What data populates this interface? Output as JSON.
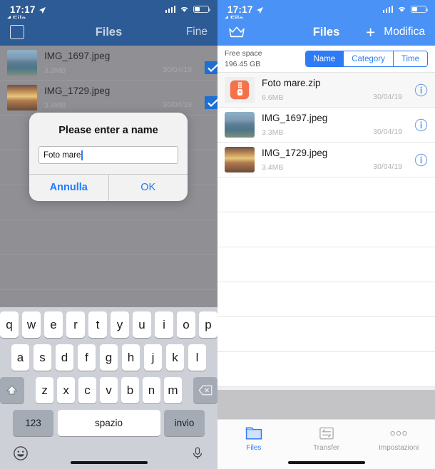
{
  "left": {
    "status": {
      "time": "17:17",
      "location_icon": "location-arrow-icon",
      "signal_icon": "cellular-bars-icon",
      "wifi_icon": "wifi-icon",
      "battery_icon": "battery-icon"
    },
    "back_label": "File",
    "nav": {
      "select_all_icon": "select-square-icon",
      "title": "Files",
      "done_label": "Fine"
    },
    "files": [
      {
        "name": "IMG_1697.jpeg",
        "size": "3.3MB",
        "date": "30/04/19",
        "thumb": "beach-thumbnail",
        "selected": true
      },
      {
        "name": "IMG_1729.jpeg",
        "size": "3.4MB",
        "date": "30/04/19",
        "thumb": "sunset-thumbnail",
        "selected": true
      }
    ],
    "dialog": {
      "title": "Please enter a name",
      "input_value": "Foto mare",
      "cancel_label": "Annulla",
      "ok_label": "OK"
    },
    "keyboard": {
      "row1": [
        "q",
        "w",
        "e",
        "r",
        "t",
        "y",
        "u",
        "i",
        "o",
        "p"
      ],
      "row2": [
        "a",
        "s",
        "d",
        "f",
        "g",
        "h",
        "j",
        "k",
        "l"
      ],
      "row3": [
        "z",
        "x",
        "c",
        "v",
        "b",
        "n",
        "m"
      ],
      "shift_icon": "shift-icon",
      "backspace_icon": "backspace-icon",
      "numbers_label": "123",
      "space_label": "spazio",
      "return_label": "invio",
      "emoji_icon": "emoji-icon",
      "dictation_icon": "microphone-icon"
    }
  },
  "right": {
    "status": {
      "time": "17:17",
      "location_icon": "location-arrow-icon",
      "signal_icon": "cellular-bars-icon",
      "wifi_icon": "wifi-icon",
      "battery_icon": "battery-icon"
    },
    "back_label": "File",
    "nav": {
      "premium_icon": "crown-icon",
      "title": "Files",
      "add_icon": "plus-icon",
      "edit_label": "Modifica"
    },
    "subbar": {
      "free_space_label": "Free space",
      "free_space_value": "196.45 GB",
      "segments": [
        {
          "label": "Name",
          "active": true
        },
        {
          "label": "Category",
          "active": false
        },
        {
          "label": "Time",
          "active": false
        }
      ]
    },
    "files": [
      {
        "name": "Foto mare.zip",
        "size": "6.6MB",
        "date": "30/04/19",
        "thumb": "zip-archive-icon",
        "info_icon": "info-icon"
      },
      {
        "name": "IMG_1697.jpeg",
        "size": "3.3MB",
        "date": "30/04/19",
        "thumb": "beach-thumbnail",
        "info_icon": "info-icon"
      },
      {
        "name": "IMG_1729.jpeg",
        "size": "3.4MB",
        "date": "30/04/19",
        "thumb": "sunset-thumbnail",
        "info_icon": "info-icon"
      }
    ],
    "tabs": [
      {
        "label": "Files",
        "icon": "folder-icon",
        "active": true
      },
      {
        "label": "Transfer",
        "icon": "transfer-icon",
        "active": false
      },
      {
        "label": "Impostazioni",
        "icon": "ellipsis-icon",
        "active": false
      }
    ]
  },
  "colors": {
    "accent_blue": "#2f7bf5",
    "nav_blue": "#4a92f5",
    "nav_blue_dimmed": "#2d5b95",
    "zip_orange": "#f4724a",
    "dim_gray": "#8f8f94"
  }
}
